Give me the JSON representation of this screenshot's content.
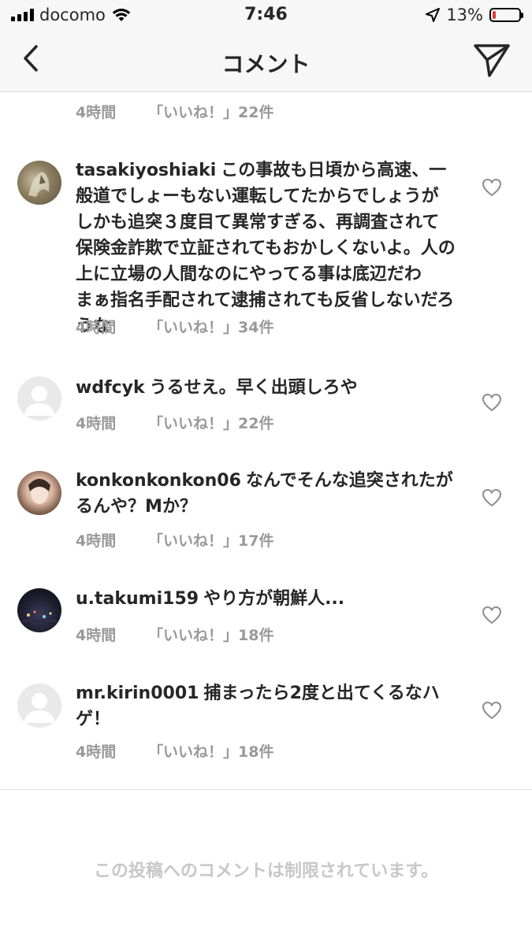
{
  "status_bar": {
    "carrier": "docomo",
    "time": "7:46",
    "battery_percent": "13%",
    "battery_level": 0.13
  },
  "nav": {
    "title": "コメント",
    "back_icon": "chevron-left-icon",
    "send_icon": "paper-plane-icon"
  },
  "top_partial": {
    "time": "4時間",
    "likes": "「いいね！」22件"
  },
  "comments": [
    {
      "user": "tasakiyoshiaki",
      "text": "この事故も日頃から高速、一般道でしょーもない運転してたからでしょうが　しかも追突３度目て異常すぎる、再調査されて保険金詐欺で立証されてもおかしくないよ。人の上に立場の人間なのにやってる事は底辺だわ　まぁ指名手配されて逮捕されても反省しないだろうな",
      "time": "4時間",
      "likes": "「いいね！」34件"
    },
    {
      "user": "wdfcyk",
      "text": "うるせえ。早く出頭しろや",
      "time": "4時間",
      "likes": "「いいね！」22件"
    },
    {
      "user": "konkonkonkon06",
      "text": "なんでそんな追突されたがるんや？Mか？",
      "time": "4時間",
      "likes": "「いいね！」17件"
    },
    {
      "user": "u.takumi159",
      "text": "やり方が朝鮮人...",
      "time": "4時間",
      "likes": "「いいね！」18件"
    },
    {
      "user": "mr.kirin0001",
      "text": "捕まったら2度と出てくるなハゲ！",
      "time": "4時間",
      "likes": "「いいね！」18件"
    }
  ],
  "footer": {
    "comments_closed": "この投稿へのコメントは制限されています。"
  }
}
